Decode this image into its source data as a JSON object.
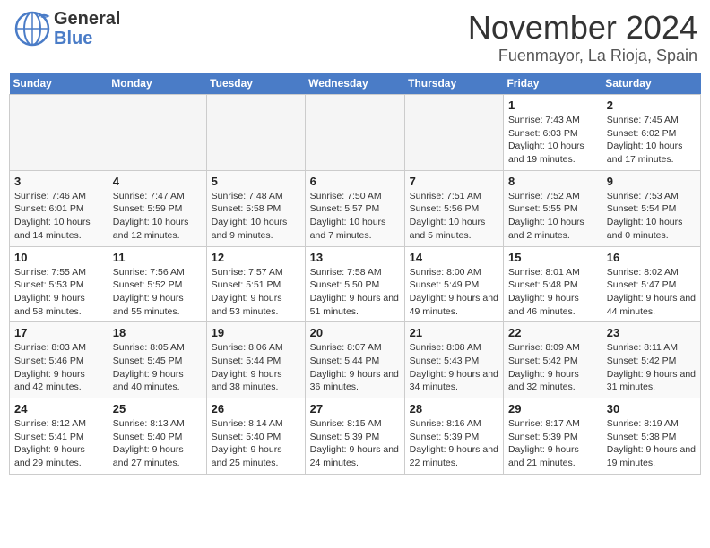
{
  "logo": {
    "line1": "General",
    "line2": "Blue"
  },
  "title": "November 2024",
  "location": "Fuenmayor, La Rioja, Spain",
  "weekdays": [
    "Sunday",
    "Monday",
    "Tuesday",
    "Wednesday",
    "Thursday",
    "Friday",
    "Saturday"
  ],
  "weeks": [
    [
      {
        "day": "",
        "info": ""
      },
      {
        "day": "",
        "info": ""
      },
      {
        "day": "",
        "info": ""
      },
      {
        "day": "",
        "info": ""
      },
      {
        "day": "",
        "info": ""
      },
      {
        "day": "1",
        "info": "Sunrise: 7:43 AM\nSunset: 6:03 PM\nDaylight: 10 hours and 19 minutes."
      },
      {
        "day": "2",
        "info": "Sunrise: 7:45 AM\nSunset: 6:02 PM\nDaylight: 10 hours and 17 minutes."
      }
    ],
    [
      {
        "day": "3",
        "info": "Sunrise: 7:46 AM\nSunset: 6:01 PM\nDaylight: 10 hours and 14 minutes."
      },
      {
        "day": "4",
        "info": "Sunrise: 7:47 AM\nSunset: 5:59 PM\nDaylight: 10 hours and 12 minutes."
      },
      {
        "day": "5",
        "info": "Sunrise: 7:48 AM\nSunset: 5:58 PM\nDaylight: 10 hours and 9 minutes."
      },
      {
        "day": "6",
        "info": "Sunrise: 7:50 AM\nSunset: 5:57 PM\nDaylight: 10 hours and 7 minutes."
      },
      {
        "day": "7",
        "info": "Sunrise: 7:51 AM\nSunset: 5:56 PM\nDaylight: 10 hours and 5 minutes."
      },
      {
        "day": "8",
        "info": "Sunrise: 7:52 AM\nSunset: 5:55 PM\nDaylight: 10 hours and 2 minutes."
      },
      {
        "day": "9",
        "info": "Sunrise: 7:53 AM\nSunset: 5:54 PM\nDaylight: 10 hours and 0 minutes."
      }
    ],
    [
      {
        "day": "10",
        "info": "Sunrise: 7:55 AM\nSunset: 5:53 PM\nDaylight: 9 hours and 58 minutes."
      },
      {
        "day": "11",
        "info": "Sunrise: 7:56 AM\nSunset: 5:52 PM\nDaylight: 9 hours and 55 minutes."
      },
      {
        "day": "12",
        "info": "Sunrise: 7:57 AM\nSunset: 5:51 PM\nDaylight: 9 hours and 53 minutes."
      },
      {
        "day": "13",
        "info": "Sunrise: 7:58 AM\nSunset: 5:50 PM\nDaylight: 9 hours and 51 minutes."
      },
      {
        "day": "14",
        "info": "Sunrise: 8:00 AM\nSunset: 5:49 PM\nDaylight: 9 hours and 49 minutes."
      },
      {
        "day": "15",
        "info": "Sunrise: 8:01 AM\nSunset: 5:48 PM\nDaylight: 9 hours and 46 minutes."
      },
      {
        "day": "16",
        "info": "Sunrise: 8:02 AM\nSunset: 5:47 PM\nDaylight: 9 hours and 44 minutes."
      }
    ],
    [
      {
        "day": "17",
        "info": "Sunrise: 8:03 AM\nSunset: 5:46 PM\nDaylight: 9 hours and 42 minutes."
      },
      {
        "day": "18",
        "info": "Sunrise: 8:05 AM\nSunset: 5:45 PM\nDaylight: 9 hours and 40 minutes."
      },
      {
        "day": "19",
        "info": "Sunrise: 8:06 AM\nSunset: 5:44 PM\nDaylight: 9 hours and 38 minutes."
      },
      {
        "day": "20",
        "info": "Sunrise: 8:07 AM\nSunset: 5:44 PM\nDaylight: 9 hours and 36 minutes."
      },
      {
        "day": "21",
        "info": "Sunrise: 8:08 AM\nSunset: 5:43 PM\nDaylight: 9 hours and 34 minutes."
      },
      {
        "day": "22",
        "info": "Sunrise: 8:09 AM\nSunset: 5:42 PM\nDaylight: 9 hours and 32 minutes."
      },
      {
        "day": "23",
        "info": "Sunrise: 8:11 AM\nSunset: 5:42 PM\nDaylight: 9 hours and 31 minutes."
      }
    ],
    [
      {
        "day": "24",
        "info": "Sunrise: 8:12 AM\nSunset: 5:41 PM\nDaylight: 9 hours and 29 minutes."
      },
      {
        "day": "25",
        "info": "Sunrise: 8:13 AM\nSunset: 5:40 PM\nDaylight: 9 hours and 27 minutes."
      },
      {
        "day": "26",
        "info": "Sunrise: 8:14 AM\nSunset: 5:40 PM\nDaylight: 9 hours and 25 minutes."
      },
      {
        "day": "27",
        "info": "Sunrise: 8:15 AM\nSunset: 5:39 PM\nDaylight: 9 hours and 24 minutes."
      },
      {
        "day": "28",
        "info": "Sunrise: 8:16 AM\nSunset: 5:39 PM\nDaylight: 9 hours and 22 minutes."
      },
      {
        "day": "29",
        "info": "Sunrise: 8:17 AM\nSunset: 5:39 PM\nDaylight: 9 hours and 21 minutes."
      },
      {
        "day": "30",
        "info": "Sunrise: 8:19 AM\nSunset: 5:38 PM\nDaylight: 9 hours and 19 minutes."
      }
    ]
  ]
}
